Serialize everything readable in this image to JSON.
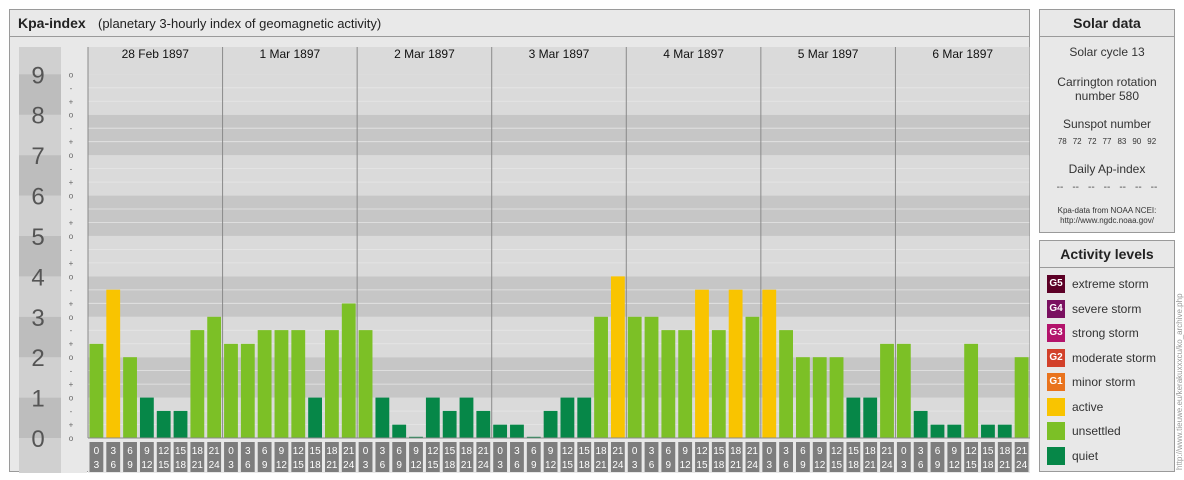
{
  "header": {
    "title": "Kpa-index",
    "subtitle": "(planetary 3-hourly index of geomagnetic activity)"
  },
  "solar": {
    "title": "Solar data",
    "cycle": "Solar cycle 13",
    "carrington_line1": "Carrington rotation",
    "carrington_line2": "number 580",
    "sunspot_label": "Sunspot number",
    "sunspots": [
      "78",
      "72",
      "72",
      "77",
      "83",
      "90",
      "92"
    ],
    "ap_label": "Daily Ap-index",
    "ap_values": [
      "--",
      "--",
      "--",
      "--",
      "--",
      "--",
      "--"
    ],
    "source_line1": "Kpa-data from NOAA NCEI:",
    "source_line2": "http://www.ngdc.noaa.gov/"
  },
  "activity": {
    "title": "Activity levels",
    "levels": [
      {
        "code": "G5",
        "label": "extreme storm",
        "color": "#5c0026"
      },
      {
        "code": "G4",
        "label": "severe storm",
        "color": "#7a1060"
      },
      {
        "code": "G3",
        "label": "strong storm",
        "color": "#b3136b"
      },
      {
        "code": "G2",
        "label": "moderate storm",
        "color": "#d2402a"
      },
      {
        "code": "G1",
        "label": "minor storm",
        "color": "#e9731d"
      },
      {
        "code": "",
        "label": "active",
        "color": "#f9c400"
      },
      {
        "code": "",
        "label": "unsettled",
        "color": "#7cc026"
      },
      {
        "code": "",
        "label": "quiet",
        "color": "#068748"
      }
    ]
  },
  "watermark": "http://www.tieuwe.eu/kerakuxxxcu/ko_archive.php",
  "chart_data": {
    "type": "bar",
    "y_ticks": [
      "0",
      "1",
      "2",
      "3",
      "4",
      "5",
      "6",
      "7",
      "8",
      "9"
    ],
    "sub_ticks": [
      "o",
      "+",
      "-",
      "o",
      "+",
      "-",
      "o",
      "+",
      "-",
      "o",
      "+",
      "-",
      "o",
      "+",
      "-",
      "o",
      "+",
      "-",
      "o",
      "+",
      "-",
      "o",
      "+",
      "-",
      "o",
      "+",
      "-",
      "o"
    ],
    "ylim": [
      0,
      9.33
    ],
    "days": [
      "28 Feb 1897",
      "1 Mar 1897",
      "2 Mar 1897",
      "3 Mar 1897",
      "4 Mar 1897",
      "5 Mar 1897",
      "6 Mar 1897"
    ],
    "hour_starts": [
      "0",
      "3",
      "6",
      "9",
      "12",
      "15",
      "18",
      "21"
    ],
    "hour_ends": [
      "3",
      "6",
      "9",
      "12",
      "15",
      "18",
      "21",
      "24"
    ],
    "values": [
      [
        2.33,
        3.67,
        2.0,
        1.0,
        0.67,
        0.67,
        2.67,
        3.0
      ],
      [
        2.33,
        2.33,
        2.67,
        2.67,
        2.67,
        1.0,
        2.67,
        3.33
      ],
      [
        2.67,
        1.0,
        0.33,
        0.0,
        1.0,
        0.67,
        1.0,
        0.67
      ],
      [
        0.33,
        0.33,
        0.0,
        0.67,
        1.0,
        1.0,
        3.0,
        4.0
      ],
      [
        3.0,
        3.0,
        2.67,
        2.67,
        3.67,
        2.67,
        3.67,
        3.0
      ],
      [
        3.67,
        2.67,
        2.0,
        2.0,
        2.0,
        1.0,
        1.0,
        2.33
      ],
      [
        2.33,
        0.67,
        0.33,
        0.33,
        2.33,
        0.33,
        0.33,
        2.0
      ]
    ],
    "colors": {
      "quiet": "#068748",
      "unsettled": "#7cc026",
      "active": "#f9c400",
      "storm": "#e9731d"
    }
  }
}
